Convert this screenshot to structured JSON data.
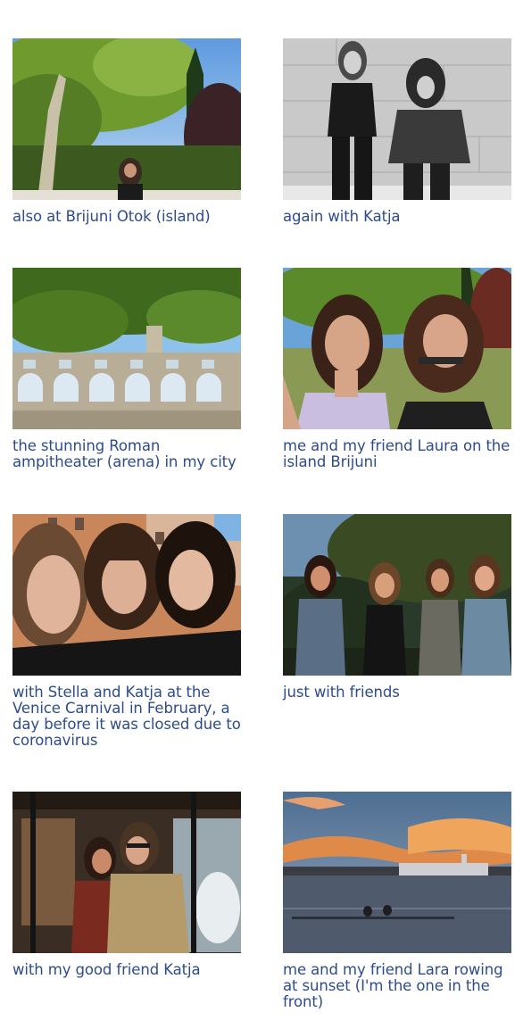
{
  "gallery": {
    "items": [
      {
        "caption": "also at Brijuni Otok (island)",
        "image": "woman-sitting-under-tree-photo"
      },
      {
        "caption": "again with Katja",
        "image": "black-and-white-two-friends-photo"
      },
      {
        "caption": "the stunning Roman ampitheater (arena) in my city",
        "image": "roman-amphitheater-arena-photo"
      },
      {
        "caption": "me and my friend Laura on the island Brijuni",
        "image": "selfie-two-friends-island-photo"
      },
      {
        "caption": "with Stella and Katja at the Venice Carnival in February, a day before it was closed due to coronavirus",
        "image": "three-friends-venice-selfie-photo"
      },
      {
        "caption": "just with friends",
        "image": "group-of-friends-sunset-photo"
      },
      {
        "caption": "with my good friend Katja",
        "image": "two-friends-tram-photo"
      },
      {
        "caption": "me and my friend Lara rowing at sunset (I'm the one in the front)",
        "image": "rowing-at-sunset-photo"
      }
    ]
  },
  "colors": {
    "caption_text": "#2e4c8c",
    "background": "#ffffff"
  }
}
